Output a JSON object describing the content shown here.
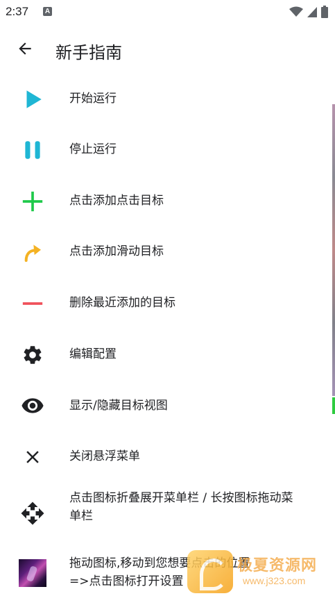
{
  "status_bar": {
    "time": "2:37",
    "notification_glyph": "A"
  },
  "header": {
    "title": "新手指南",
    "back_icon": "arrow-left-icon"
  },
  "items": [
    {
      "label": "开始运行",
      "icon": "play-icon",
      "color": "#1fb6d4"
    },
    {
      "label": "停止运行",
      "icon": "pause-icon",
      "color": "#1fb6d4"
    },
    {
      "label": "点击添加点击目标",
      "icon": "plus-icon",
      "color": "#1ec94a"
    },
    {
      "label": "点击添加滑动目标",
      "icon": "swipe-arrow-icon",
      "color": "#f4b223"
    },
    {
      "label": "删除最近添加的目标",
      "icon": "minus-icon",
      "color": "#f0505a"
    },
    {
      "label": "编辑配置",
      "icon": "gear-icon",
      "color": "#202124"
    },
    {
      "label": "显示/隐藏目标视图",
      "icon": "eye-icon",
      "color": "#202124"
    },
    {
      "label": "关闭悬浮菜单",
      "icon": "close-icon",
      "color": "#202124"
    },
    {
      "label_line1": "点击图标折叠展开菜单栏 / 长按图标拖动菜",
      "label_line2": "单栏",
      "icon": "move-icon",
      "color": "#202124"
    },
    {
      "label_line1": "拖动图标,移动到您想要点击的位置",
      "label_line2": "=>点击图标打开设置",
      "icon": "app-thumbnail-icon"
    }
  ],
  "watermark": {
    "name": "极夏资源网",
    "url": "www.j323.com"
  }
}
